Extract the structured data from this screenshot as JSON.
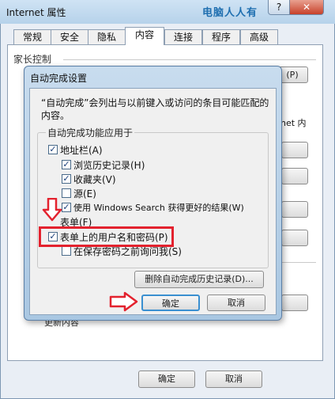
{
  "outer": {
    "title": "Internet 属性",
    "watermark": "电脑人人有",
    "help_label": "?",
    "close_label": "✕",
    "tabs": [
      {
        "label": "常规"
      },
      {
        "label": "安全"
      },
      {
        "label": "隐私"
      },
      {
        "label": "内容"
      },
      {
        "label": "连接"
      },
      {
        "label": "程序"
      },
      {
        "label": "高级"
      }
    ],
    "active_tab": "内容",
    "parental_control_label": "家长控制",
    "partial_button_text": "(P)",
    "partial_side_text": "net 内",
    "bottom_partial_text": "更新内容",
    "ok_label": "确定",
    "cancel_label": "取消"
  },
  "dialog": {
    "title": "自动完成设置",
    "description": "“自动完成”会列出与以前键入或访问的条目可能匹配的内容。",
    "group_label": "自动完成功能应用于",
    "items": [
      {
        "label": "地址栏(A)",
        "checked": true
      },
      {
        "label": "浏览历史记录(H)",
        "checked": true
      },
      {
        "label": "收藏夹(V)",
        "checked": true
      },
      {
        "label": "源(E)",
        "checked": false
      },
      {
        "label": "使用 Windows Search 获得更好的结果(W)",
        "checked": true
      },
      {
        "label": "表单(F)",
        "checked": false
      },
      {
        "label": "表单上的用户名和密码(P)",
        "checked": true
      },
      {
        "label": "在保存密码之前询问我(S)",
        "checked": false
      }
    ],
    "clear_history_label": "删除自动完成历史记录(D)...",
    "ok_label": "确定",
    "cancel_label": "取消"
  },
  "annotation_colors": {
    "highlight": "#e3222e",
    "arrow": "#e3222e"
  }
}
